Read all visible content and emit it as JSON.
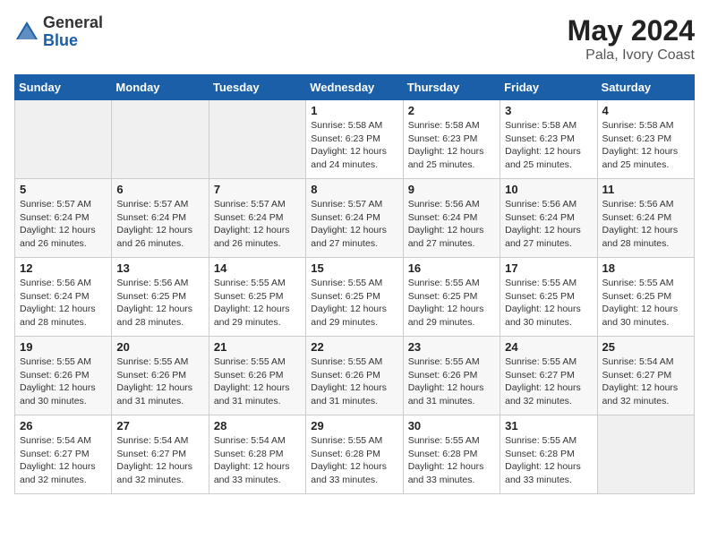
{
  "header": {
    "logo_general": "General",
    "logo_blue": "Blue",
    "title": "May 2024",
    "location": "Pala, Ivory Coast"
  },
  "days_of_week": [
    "Sunday",
    "Monday",
    "Tuesday",
    "Wednesday",
    "Thursday",
    "Friday",
    "Saturday"
  ],
  "weeks": [
    [
      {
        "day": "",
        "info": ""
      },
      {
        "day": "",
        "info": ""
      },
      {
        "day": "",
        "info": ""
      },
      {
        "day": "1",
        "info": "Sunrise: 5:58 AM\nSunset: 6:23 PM\nDaylight: 12 hours\nand 24 minutes."
      },
      {
        "day": "2",
        "info": "Sunrise: 5:58 AM\nSunset: 6:23 PM\nDaylight: 12 hours\nand 25 minutes."
      },
      {
        "day": "3",
        "info": "Sunrise: 5:58 AM\nSunset: 6:23 PM\nDaylight: 12 hours\nand 25 minutes."
      },
      {
        "day": "4",
        "info": "Sunrise: 5:58 AM\nSunset: 6:23 PM\nDaylight: 12 hours\nand 25 minutes."
      }
    ],
    [
      {
        "day": "5",
        "info": "Sunrise: 5:57 AM\nSunset: 6:24 PM\nDaylight: 12 hours\nand 26 minutes."
      },
      {
        "day": "6",
        "info": "Sunrise: 5:57 AM\nSunset: 6:24 PM\nDaylight: 12 hours\nand 26 minutes."
      },
      {
        "day": "7",
        "info": "Sunrise: 5:57 AM\nSunset: 6:24 PM\nDaylight: 12 hours\nand 26 minutes."
      },
      {
        "day": "8",
        "info": "Sunrise: 5:57 AM\nSunset: 6:24 PM\nDaylight: 12 hours\nand 27 minutes."
      },
      {
        "day": "9",
        "info": "Sunrise: 5:56 AM\nSunset: 6:24 PM\nDaylight: 12 hours\nand 27 minutes."
      },
      {
        "day": "10",
        "info": "Sunrise: 5:56 AM\nSunset: 6:24 PM\nDaylight: 12 hours\nand 27 minutes."
      },
      {
        "day": "11",
        "info": "Sunrise: 5:56 AM\nSunset: 6:24 PM\nDaylight: 12 hours\nand 28 minutes."
      }
    ],
    [
      {
        "day": "12",
        "info": "Sunrise: 5:56 AM\nSunset: 6:24 PM\nDaylight: 12 hours\nand 28 minutes."
      },
      {
        "day": "13",
        "info": "Sunrise: 5:56 AM\nSunset: 6:25 PM\nDaylight: 12 hours\nand 28 minutes."
      },
      {
        "day": "14",
        "info": "Sunrise: 5:55 AM\nSunset: 6:25 PM\nDaylight: 12 hours\nand 29 minutes."
      },
      {
        "day": "15",
        "info": "Sunrise: 5:55 AM\nSunset: 6:25 PM\nDaylight: 12 hours\nand 29 minutes."
      },
      {
        "day": "16",
        "info": "Sunrise: 5:55 AM\nSunset: 6:25 PM\nDaylight: 12 hours\nand 29 minutes."
      },
      {
        "day": "17",
        "info": "Sunrise: 5:55 AM\nSunset: 6:25 PM\nDaylight: 12 hours\nand 30 minutes."
      },
      {
        "day": "18",
        "info": "Sunrise: 5:55 AM\nSunset: 6:25 PM\nDaylight: 12 hours\nand 30 minutes."
      }
    ],
    [
      {
        "day": "19",
        "info": "Sunrise: 5:55 AM\nSunset: 6:26 PM\nDaylight: 12 hours\nand 30 minutes."
      },
      {
        "day": "20",
        "info": "Sunrise: 5:55 AM\nSunset: 6:26 PM\nDaylight: 12 hours\nand 31 minutes."
      },
      {
        "day": "21",
        "info": "Sunrise: 5:55 AM\nSunset: 6:26 PM\nDaylight: 12 hours\nand 31 minutes."
      },
      {
        "day": "22",
        "info": "Sunrise: 5:55 AM\nSunset: 6:26 PM\nDaylight: 12 hours\nand 31 minutes."
      },
      {
        "day": "23",
        "info": "Sunrise: 5:55 AM\nSunset: 6:26 PM\nDaylight: 12 hours\nand 31 minutes."
      },
      {
        "day": "24",
        "info": "Sunrise: 5:55 AM\nSunset: 6:27 PM\nDaylight: 12 hours\nand 32 minutes."
      },
      {
        "day": "25",
        "info": "Sunrise: 5:54 AM\nSunset: 6:27 PM\nDaylight: 12 hours\nand 32 minutes."
      }
    ],
    [
      {
        "day": "26",
        "info": "Sunrise: 5:54 AM\nSunset: 6:27 PM\nDaylight: 12 hours\nand 32 minutes."
      },
      {
        "day": "27",
        "info": "Sunrise: 5:54 AM\nSunset: 6:27 PM\nDaylight: 12 hours\nand 32 minutes."
      },
      {
        "day": "28",
        "info": "Sunrise: 5:54 AM\nSunset: 6:28 PM\nDaylight: 12 hours\nand 33 minutes."
      },
      {
        "day": "29",
        "info": "Sunrise: 5:55 AM\nSunset: 6:28 PM\nDaylight: 12 hours\nand 33 minutes."
      },
      {
        "day": "30",
        "info": "Sunrise: 5:55 AM\nSunset: 6:28 PM\nDaylight: 12 hours\nand 33 minutes."
      },
      {
        "day": "31",
        "info": "Sunrise: 5:55 AM\nSunset: 6:28 PM\nDaylight: 12 hours\nand 33 minutes."
      },
      {
        "day": "",
        "info": ""
      }
    ]
  ]
}
